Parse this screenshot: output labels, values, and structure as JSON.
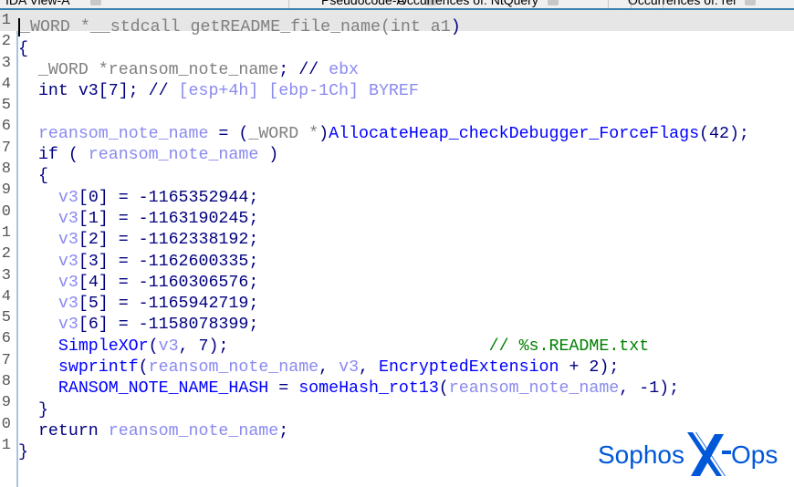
{
  "tabs": [
    {
      "label": "IDA View-A"
    },
    {
      "label": "Pseudocode-A"
    },
    {
      "label": "Occurrences of: NtQuery"
    },
    {
      "label": "Occurrences of: rei"
    }
  ],
  "logo": {
    "text": "Sophos X-Ops",
    "brand_color": "#0057d8"
  },
  "lines": [
    {
      "num": "1",
      "tokens": [
        {
          "t": "_WORD *__stdcall getREADME_file_name(",
          "c": "ty"
        },
        {
          "t": "int a1",
          "c": "ty"
        },
        {
          "t": ")",
          "c": "kw"
        }
      ]
    },
    {
      "num": "2",
      "tokens": [
        {
          "t": "{",
          "c": "kw"
        }
      ]
    },
    {
      "num": "3",
      "tokens": [
        {
          "t": "  ",
          "c": "kw"
        },
        {
          "t": "_WORD *reansom_note_name",
          "c": "ty"
        },
        {
          "t": "; // ",
          "c": "kw"
        },
        {
          "t": "ebx",
          "c": "va"
        }
      ]
    },
    {
      "num": "4",
      "tokens": [
        {
          "t": "  int v3[7]; // ",
          "c": "kw"
        },
        {
          "t": "[esp+4h] [ebp-1Ch] BYREF",
          "c": "va"
        }
      ]
    },
    {
      "num": "5",
      "tokens": []
    },
    {
      "num": "6",
      "tokens": [
        {
          "t": "  ",
          "c": "kw"
        },
        {
          "t": "reansom_note_name",
          "c": "va"
        },
        {
          "t": " = (",
          "c": "kw"
        },
        {
          "t": "_WORD *",
          "c": "ty"
        },
        {
          "t": ")",
          "c": "kw"
        },
        {
          "t": "AllocateHeap_checkDebugger_ForceFlags",
          "c": "fn"
        },
        {
          "t": "(42);",
          "c": "kw"
        }
      ]
    },
    {
      "num": "7",
      "tokens": [
        {
          "t": "  if ( ",
          "c": "kw"
        },
        {
          "t": "reansom_note_name",
          "c": "va"
        },
        {
          "t": " )",
          "c": "kw"
        }
      ]
    },
    {
      "num": "8",
      "tokens": [
        {
          "t": "  {",
          "c": "kw"
        }
      ]
    },
    {
      "num": "9",
      "tokens": [
        {
          "t": "    ",
          "c": "kw"
        },
        {
          "t": "v3",
          "c": "va"
        },
        {
          "t": "[0] = -1165352944;",
          "c": "kw"
        }
      ]
    },
    {
      "num": "0",
      "tokens": [
        {
          "t": "    ",
          "c": "kw"
        },
        {
          "t": "v3",
          "c": "va"
        },
        {
          "t": "[1] = -1163190245;",
          "c": "kw"
        }
      ]
    },
    {
      "num": "1",
      "tokens": [
        {
          "t": "    ",
          "c": "kw"
        },
        {
          "t": "v3",
          "c": "va"
        },
        {
          "t": "[2] = -1162338192;",
          "c": "kw"
        }
      ]
    },
    {
      "num": "2",
      "tokens": [
        {
          "t": "    ",
          "c": "kw"
        },
        {
          "t": "v3",
          "c": "va"
        },
        {
          "t": "[3] = -1162600335;",
          "c": "kw"
        }
      ]
    },
    {
      "num": "3",
      "tokens": [
        {
          "t": "    ",
          "c": "kw"
        },
        {
          "t": "v3",
          "c": "va"
        },
        {
          "t": "[4] = -1160306576;",
          "c": "kw"
        }
      ]
    },
    {
      "num": "4",
      "tokens": [
        {
          "t": "    ",
          "c": "kw"
        },
        {
          "t": "v3",
          "c": "va"
        },
        {
          "t": "[5] = -1165942719;",
          "c": "kw"
        }
      ]
    },
    {
      "num": "5",
      "tokens": [
        {
          "t": "    ",
          "c": "kw"
        },
        {
          "t": "v3",
          "c": "va"
        },
        {
          "t": "[6] = -1158078399;",
          "c": "kw"
        }
      ]
    },
    {
      "num": "6",
      "tokens": [
        {
          "t": "    ",
          "c": "kw"
        },
        {
          "t": "SimpleXOr",
          "c": "fn"
        },
        {
          "t": "(",
          "c": "kw"
        },
        {
          "t": "v3",
          "c": "va"
        },
        {
          "t": ", 7);                          ",
          "c": "kw"
        },
        {
          "t": "// %s.README.txt",
          "c": "cm"
        }
      ]
    },
    {
      "num": "7",
      "tokens": [
        {
          "t": "    ",
          "c": "kw"
        },
        {
          "t": "swprintf",
          "c": "fn"
        },
        {
          "t": "(",
          "c": "kw"
        },
        {
          "t": "reansom_note_name",
          "c": "va"
        },
        {
          "t": ", ",
          "c": "kw"
        },
        {
          "t": "v3",
          "c": "va"
        },
        {
          "t": ", ",
          "c": "kw"
        },
        {
          "t": "EncryptedExtension",
          "c": "fn"
        },
        {
          "t": " + 2);",
          "c": "kw"
        }
      ]
    },
    {
      "num": "8",
      "tokens": [
        {
          "t": "    ",
          "c": "kw"
        },
        {
          "t": "RANSOM_NOTE_NAME_HASH",
          "c": "fn"
        },
        {
          "t": " = ",
          "c": "kw"
        },
        {
          "t": "someHash_rot13",
          "c": "fn"
        },
        {
          "t": "(",
          "c": "kw"
        },
        {
          "t": "reansom_note_name",
          "c": "va"
        },
        {
          "t": ", -1);",
          "c": "kw"
        }
      ]
    },
    {
      "num": "9",
      "tokens": [
        {
          "t": "  }",
          "c": "kw"
        }
      ]
    },
    {
      "num": "0",
      "tokens": [
        {
          "t": "  return ",
          "c": "kw"
        },
        {
          "t": "reansom_note_name",
          "c": "va"
        },
        {
          "t": ";",
          "c": "kw"
        }
      ]
    },
    {
      "num": "1",
      "tokens": [
        {
          "t": "}",
          "c": "kw"
        }
      ]
    }
  ]
}
